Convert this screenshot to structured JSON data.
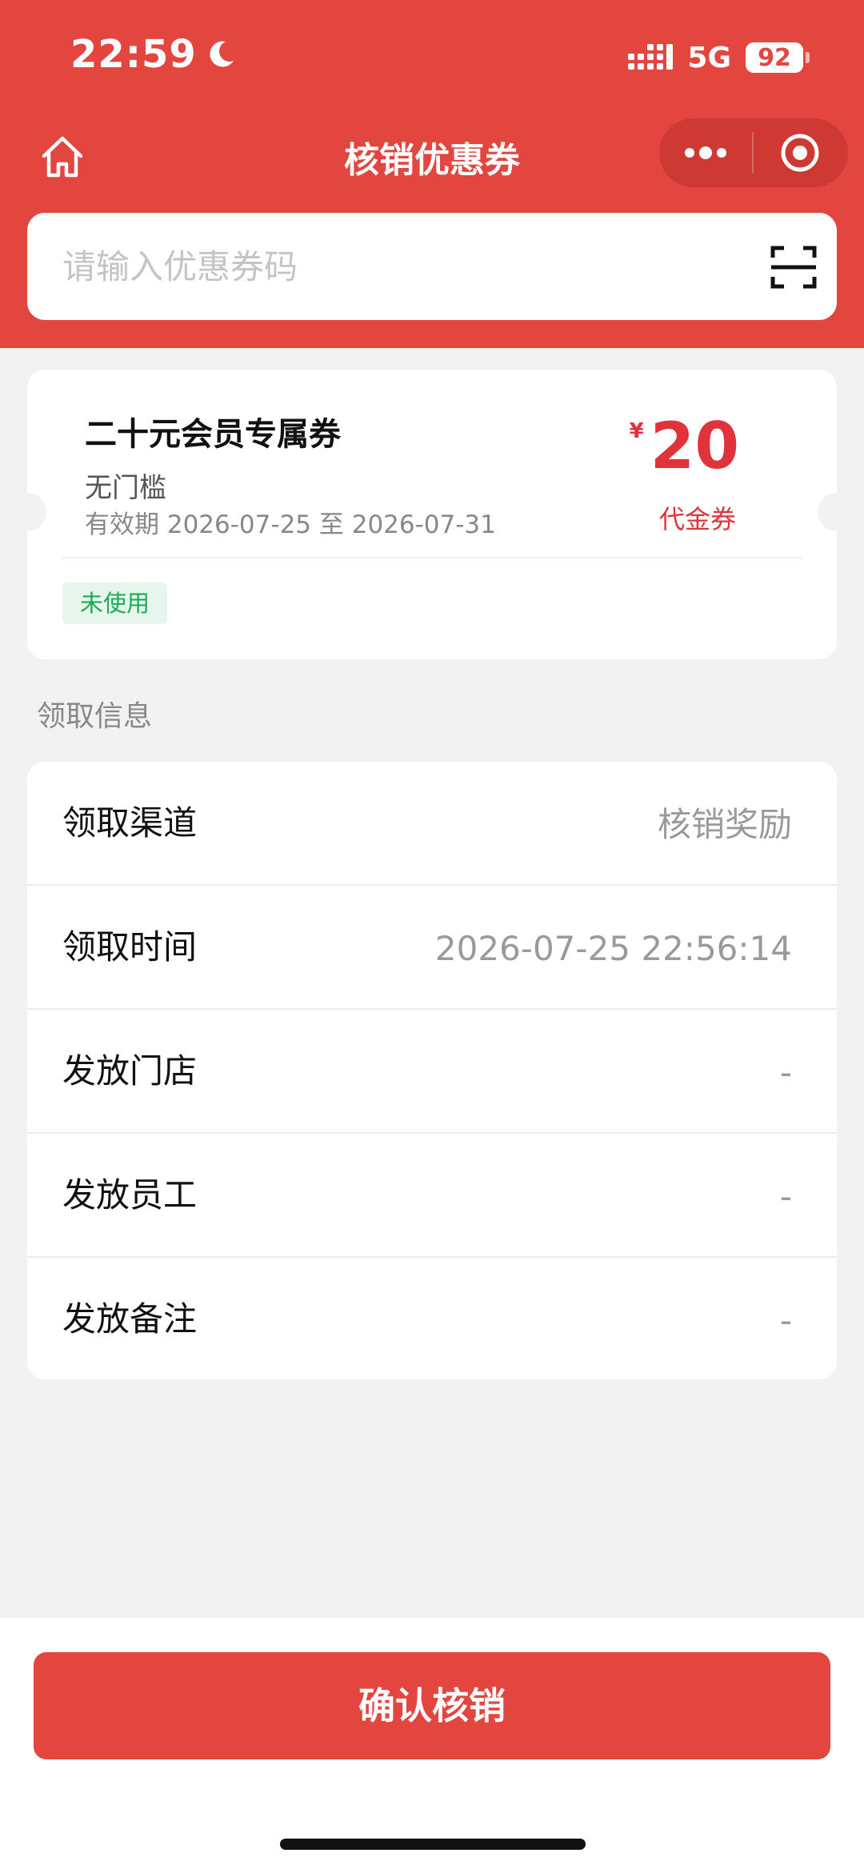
{
  "status_bar": {
    "time": "22:59",
    "network": "5G",
    "battery": "92",
    "icons": [
      "moon-icon",
      "signal-icon",
      "battery-icon"
    ]
  },
  "nav": {
    "title": "核销优惠券",
    "icons": [
      "home-icon",
      "more-icon",
      "close-target-icon"
    ]
  },
  "search": {
    "placeholder": "请输入优惠券码",
    "value": "",
    "icon": "scan-icon"
  },
  "coupon": {
    "title": "二十元会员专属券",
    "threshold": "无门槛",
    "validity": "有效期 2026-07-25 至 2026-07-31",
    "currency": "¥",
    "amount": "20",
    "type": "代金券",
    "status": "未使用"
  },
  "section": {
    "title": "领取信息"
  },
  "info": {
    "rows": [
      {
        "label": "领取渠道",
        "value": "核销奖励"
      },
      {
        "label": "领取时间",
        "value": "2026-07-25 22:56:14"
      },
      {
        "label": "发放门店",
        "value": "-"
      },
      {
        "label": "发放员工",
        "value": "-"
      },
      {
        "label": "发放备注",
        "value": "-"
      }
    ]
  },
  "actions": {
    "confirm_label": "确认核销"
  },
  "colors": {
    "brand_red": "#e3453f",
    "amount_red": "#e0343c",
    "status_green": "#1aaa55",
    "status_green_bg": "#e6f6ec",
    "page_bg": "#f2f2f2"
  }
}
